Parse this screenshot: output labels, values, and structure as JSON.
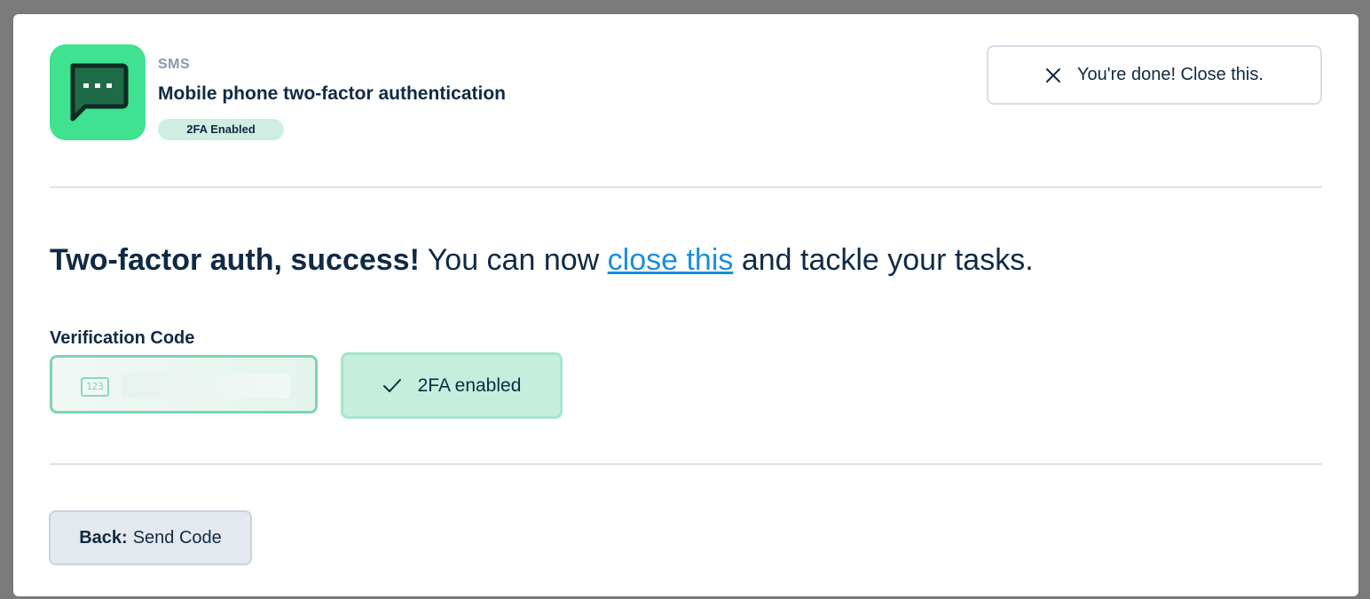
{
  "header": {
    "eyebrow": "SMS",
    "title": "Mobile phone two-factor authentication",
    "badge": "2FA Enabled",
    "app_icon": "message-dots-icon",
    "close_label": "You're done! Close this.",
    "close_icon": "close-icon"
  },
  "main": {
    "headline_bold": "Two-factor auth, success!",
    "headline_pre": " You can now ",
    "headline_link": "close this",
    "headline_post": " and tackle your tasks.",
    "field_label": "Verification Code",
    "input_icon_text": "123",
    "input_value": "",
    "status_label": "2FA enabled",
    "status_icon": "check-icon"
  },
  "footer": {
    "back_prefix": "Back:",
    "back_label": "Send Code"
  },
  "colors": {
    "brand_green": "#3ee28f",
    "link_blue": "#1a8fdb",
    "text_dark": "#0f2a44",
    "success_bg": "#c6eedd"
  }
}
